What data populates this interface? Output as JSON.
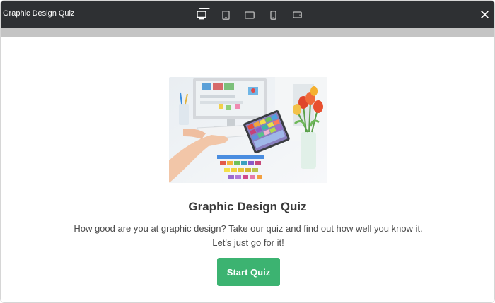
{
  "window": {
    "title": "Graphic Design Quiz"
  },
  "device_toolbar": {
    "items": [
      {
        "icon": "desktop-icon",
        "active": true
      },
      {
        "icon": "tablet-icon",
        "active": false
      },
      {
        "icon": "tablet-landscape-icon",
        "active": false
      },
      {
        "icon": "mobile-icon",
        "active": false
      },
      {
        "icon": "mobile-landscape-icon",
        "active": false
      }
    ],
    "close_icon": "close-icon"
  },
  "quiz": {
    "image": "design-workspace-image",
    "title": "Graphic Design Quiz",
    "description_line1": "How good are you at graphic design? Take our quiz and find out how well you know it.",
    "description_line2": "Let's just go for it!",
    "start_label": "Start Quiz"
  },
  "colors": {
    "topbar": "#2e3033",
    "accent_button": "#3cb371",
    "gray_strip": "#c4c4c4"
  }
}
